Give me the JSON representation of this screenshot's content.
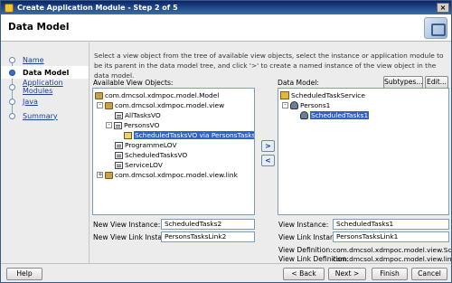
{
  "window": {
    "title": "Create Application Module - Step 2 of 5"
  },
  "header": {
    "title": "Data Model"
  },
  "nav": {
    "items": [
      {
        "label": "Name",
        "active": false
      },
      {
        "label": "Data Model",
        "active": true
      },
      {
        "label": "Application Modules",
        "active": false
      },
      {
        "label": "Java",
        "active": false
      },
      {
        "label": "Summary",
        "active": false
      }
    ]
  },
  "intro": {
    "text": "Select a view object from the tree of available view objects, select the instance or application module to be its parent in the data model tree, and click '>' to create a named instance of the view object in the data model."
  },
  "available": {
    "label": "Available View Objects:",
    "rows": [
      {
        "text": "com.dmcsol.xdmpoc.model.Model",
        "icon": "package"
      },
      {
        "text": "com.dmcsol.xdmpoc.model.view",
        "icon": "package",
        "expander": "-"
      },
      {
        "text": "AllTasksVO",
        "icon": "view-object"
      },
      {
        "text": "PersonsVO",
        "icon": "view-object",
        "expander": "-"
      },
      {
        "text": "ScheduledTasksVO via PersonsTasksLink",
        "icon": "view-link",
        "selected": true
      },
      {
        "text": "ProgrammeLOV",
        "icon": "view-object"
      },
      {
        "text": "ScheduledTasksVO",
        "icon": "view-object"
      },
      {
        "text": "ServiceLOV",
        "icon": "view-object"
      },
      {
        "text": "com.dmcsol.xdmpoc.model.view.link",
        "icon": "package",
        "expander": "+"
      }
    ]
  },
  "shuttle": {
    "add_label": ">",
    "remove_label": "<"
  },
  "datamodel": {
    "label": "Data Model:",
    "subtypes_label": "Subtypes...",
    "edit_label": "Edit...",
    "rows": [
      {
        "text": "ScheduledTaskService",
        "icon": "service"
      },
      {
        "text": "Persons1",
        "icon": "view-instance",
        "expander": "-"
      },
      {
        "text": "ScheduledTasks1",
        "icon": "view-instance",
        "selected": true
      }
    ]
  },
  "left_fields": {
    "view_instance_label": "New View Instance:",
    "view_instance_value": "ScheduledTasks2",
    "view_link_label": "New View Link Instance:",
    "view_link_value": "PersonsTasksLink2"
  },
  "right_fields": {
    "view_instance_label": "View Instance:",
    "view_instance_value": "ScheduledTasks1",
    "view_link_label": "View Link Instance:",
    "view_link_value": "PersonsTasksLink1",
    "view_definition_label": "View Definition:",
    "view_definition_value": "com.dmcsol.xdmpoc.model.view.Sche...",
    "view_link_definition_label": "View Link Definition:",
    "view_link_definition_value": "com.dmcsol.xdmpoc.model.view.link.P..."
  },
  "footer": {
    "help_label": "Help",
    "back_label": "< Back",
    "next_label": "Next >",
    "finish_label": "Finish",
    "cancel_label": "Cancel"
  }
}
